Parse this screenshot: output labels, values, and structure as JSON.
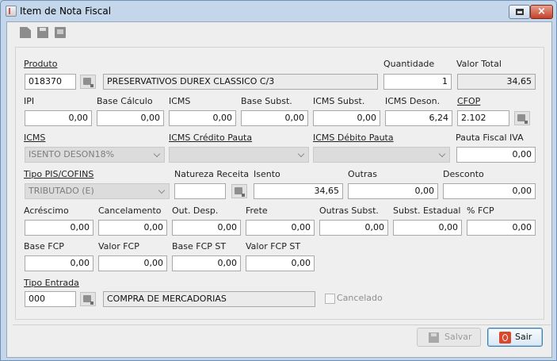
{
  "window": {
    "title": "Item de Nota Fiscal",
    "close_glyph": "×"
  },
  "toolbar": {
    "icons": [
      "new-document-icon",
      "save-icon",
      "print-icon"
    ]
  },
  "produto": {
    "label": "Produto",
    "code": "018370",
    "description": "PRESERVATIVOS DUREX CLASSICO C/3"
  },
  "quantidade": {
    "label": "Quantidade",
    "value": "1"
  },
  "valor_total": {
    "label": "Valor Total",
    "value": "34,65"
  },
  "ipi": {
    "label": "IPI",
    "value": "0,00"
  },
  "base_calculo": {
    "label": "Base Cálculo",
    "value": "0,00"
  },
  "icms": {
    "label": "ICMS",
    "value": "0,00"
  },
  "base_subst": {
    "label": "Base Subst.",
    "value": "0,00"
  },
  "icms_subst": {
    "label": "ICMS Subst.",
    "value": "0,00"
  },
  "icms_deson": {
    "label": "ICMS Deson.",
    "value": "6,24"
  },
  "cfop": {
    "label": "CFOP",
    "value": "2.102"
  },
  "icms_combo": {
    "label": "ICMS",
    "value": "ISENTO DESON18%"
  },
  "icms_credito_pauta": {
    "label": "ICMS Crédito Pauta",
    "value": ""
  },
  "icms_debito_pauta": {
    "label": "ICMS Débito Pauta",
    "value": ""
  },
  "pauta_fiscal_iva": {
    "label": "Pauta Fiscal IVA",
    "value": "0,00"
  },
  "tipo_pis_cofins": {
    "label": "Tipo PIS/COFINS",
    "value": "TRIBUTADO (E)"
  },
  "natureza_receita": {
    "label": "Natureza Receita",
    "value": ""
  },
  "isento": {
    "label": "Isento",
    "value": "34,65"
  },
  "outras": {
    "label": "Outras",
    "value": "0,00"
  },
  "desconto": {
    "label": "Desconto",
    "value": "0,00"
  },
  "acrescimo": {
    "label": "Acréscimo",
    "value": "0,00"
  },
  "cancelamento": {
    "label": "Cancelamento",
    "value": "0,00"
  },
  "out_desp": {
    "label": "Out. Desp.",
    "value": "0,00"
  },
  "frete": {
    "label": "Frete",
    "value": "0,00"
  },
  "outras_subst": {
    "label": "Outras Subst.",
    "value": "0,00"
  },
  "subst_estadual": {
    "label": "Subst. Estadual",
    "value": "0,00"
  },
  "pct_fcp": {
    "label": "% FCP",
    "value": "0,00"
  },
  "base_fcp": {
    "label": "Base FCP",
    "value": "0,00"
  },
  "valor_fcp": {
    "label": "Valor FCP",
    "value": "0,00"
  },
  "base_fcp_st": {
    "label": "Base FCP ST",
    "value": "0,00"
  },
  "valor_fcp_st": {
    "label": "Valor FCP ST",
    "value": "0,00"
  },
  "tipo_entrada": {
    "label": "Tipo Entrada",
    "code": "000",
    "description": "COMPRA DE MERCADORIAS"
  },
  "cancelado": {
    "label": "Cancelado",
    "checked": false
  },
  "buttons": {
    "salvar": "Salvar",
    "sair": "Sair"
  }
}
